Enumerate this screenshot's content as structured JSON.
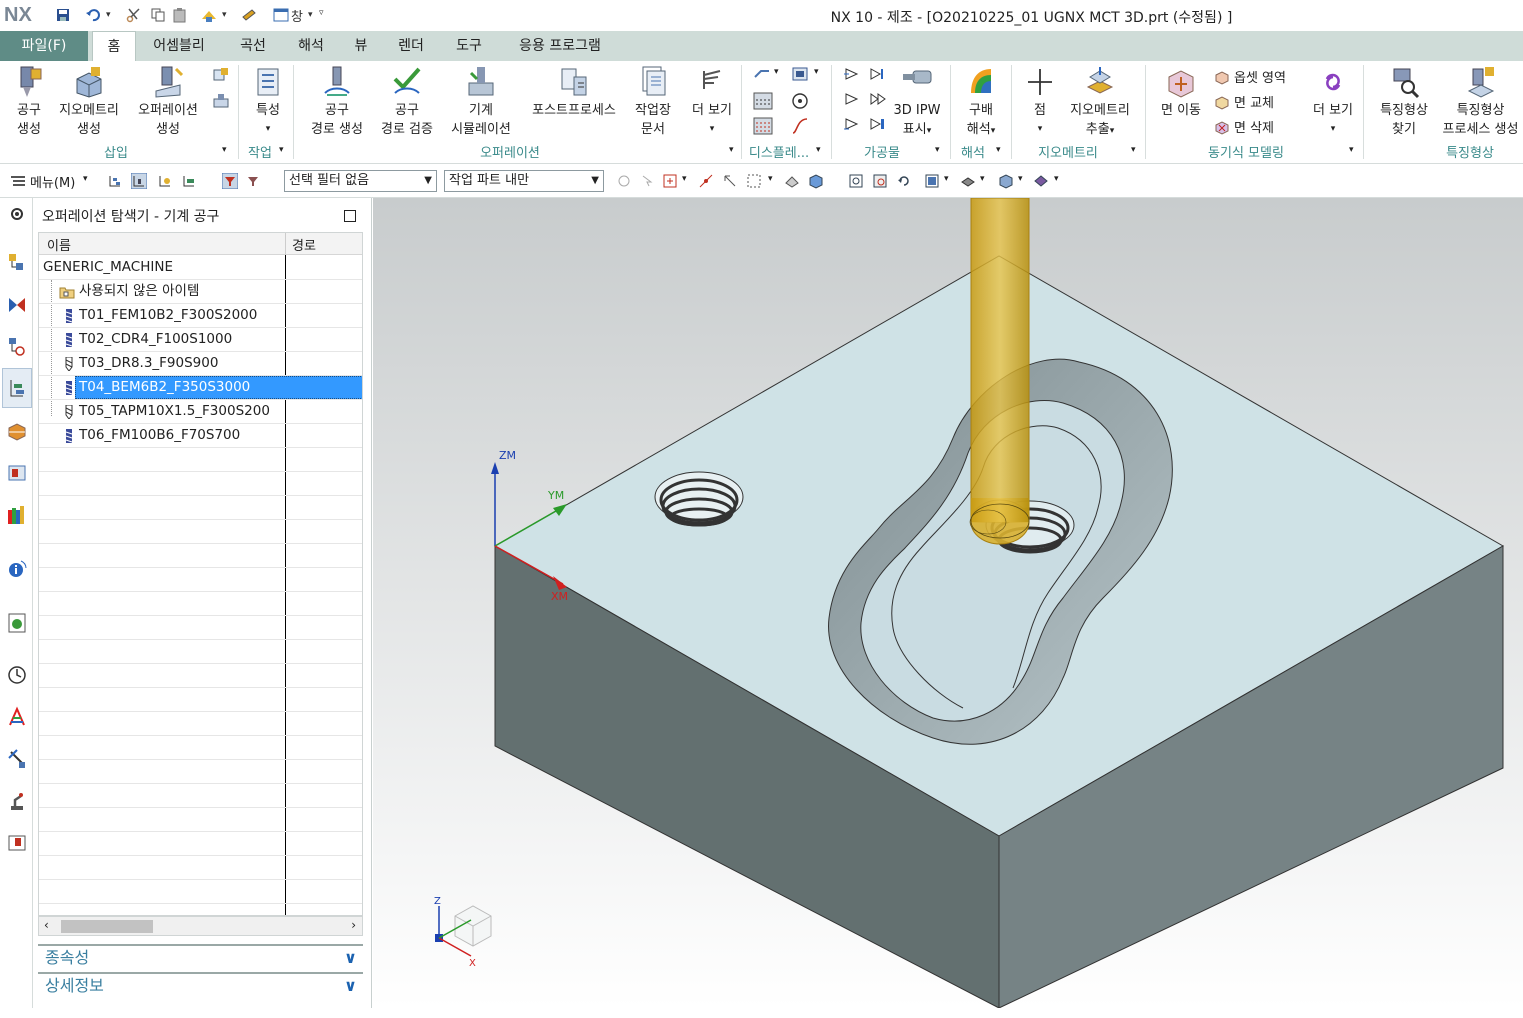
{
  "app": {
    "logo": "NX",
    "title": "NX 10 - 제조 - [O20210225_01 UGNX MCT 3D.prt (수정됨) ]",
    "window_menu": "창"
  },
  "tabs": [
    {
      "label": "파일(F)"
    },
    {
      "label": "홈"
    },
    {
      "label": "어셈블리"
    },
    {
      "label": "곡선"
    },
    {
      "label": "해석"
    },
    {
      "label": "뷰"
    },
    {
      "label": "렌더"
    },
    {
      "label": "도구"
    },
    {
      "label": "응용 프로그램"
    }
  ],
  "ribbon": {
    "insert": {
      "group": "삽입",
      "tool_create": [
        "공구",
        "생성"
      ],
      "geometry_create": [
        "지오메트리",
        "생성"
      ],
      "operation_create": [
        "오퍼레이션",
        "생성"
      ]
    },
    "work": {
      "group": "작업",
      "properties": "특성"
    },
    "operation": {
      "group": "오퍼레이션",
      "toolpath_create": [
        "공구",
        "경로 생성"
      ],
      "toolpath_verify": [
        "공구",
        "경로 검증"
      ],
      "machine_sim": [
        "기계",
        "시뮬레이션"
      ],
      "postprocess": "포스트프로세스",
      "shop_doc": [
        "작업장",
        "문서"
      ],
      "more": [
        "더 보기"
      ]
    },
    "display": {
      "group": "디스플레..."
    },
    "workpiece": {
      "group": "가공물",
      "ipw": [
        "3D IPW",
        "표시"
      ]
    },
    "analysis": {
      "group": "해석",
      "slope": [
        "구배",
        "해석"
      ]
    },
    "geometry": {
      "group": "지오메트리",
      "point": "점",
      "extract": [
        "지오메트리",
        "추출"
      ]
    },
    "sync": {
      "group": "동기식 모델링",
      "move_face": "면 이동",
      "offset_region": "옵셋 영역",
      "replace_face": "면 교체",
      "delete_face": "면 삭제",
      "more": "더 보기"
    },
    "feature": {
      "group": "특징형상",
      "find": [
        "특징형상",
        "찾기"
      ],
      "process": [
        "특징형상",
        "프로세스 생성"
      ]
    }
  },
  "toolbar": {
    "menu": "메뉴(M)",
    "selection_filter": "선택 필터 없음",
    "scope": "작업 파트 내만"
  },
  "navigator": {
    "title": "오퍼레이션 탐색기 - 기계 공구",
    "columns": [
      "이름",
      "경로"
    ],
    "root": "GENERIC_MACHINE",
    "items": [
      {
        "name": "사용되지 않은 아이템",
        "type": "folder",
        "selected": false
      },
      {
        "name": "T01_FEM10B2_F300S2000",
        "type": "mill",
        "selected": false
      },
      {
        "name": "T02_CDR4_F100S1000",
        "type": "mill",
        "selected": false
      },
      {
        "name": "T03_DR8.3_F90S900",
        "type": "drill",
        "selected": false
      },
      {
        "name": "T04_BEM6B2_F350S3000",
        "type": "mill",
        "selected": true
      },
      {
        "name": "T05_TAPM10X1.5_F300S200",
        "type": "drill",
        "selected": false
      },
      {
        "name": "T06_FM100B6_F70S700",
        "type": "mill",
        "selected": false
      }
    ],
    "sections": [
      {
        "label": "종속성"
      },
      {
        "label": "상세정보"
      }
    ]
  },
  "viewport": {
    "axis_labels": {
      "z": "ZM",
      "y": "YM",
      "x": "XM"
    },
    "triad": {
      "z": "Z",
      "x": "X"
    },
    "colors": {
      "top_face": "#cfe2e6",
      "side_left": "#6a7a7b",
      "side_right": "#7d8c8e",
      "tool": "#c9a21a",
      "background_top": "#c8cccd",
      "background_bottom": "#ffffff"
    }
  }
}
